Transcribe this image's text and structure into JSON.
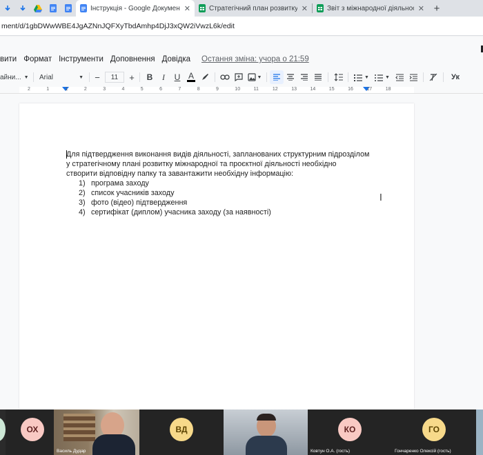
{
  "browser": {
    "tabs": [
      {
        "title": "Інструкція - Google Документи",
        "active": true,
        "icon_color": "#4285f4"
      },
      {
        "title": "Стратегічний план розвитку між",
        "active": false,
        "icon_color": "#0f9d58"
      },
      {
        "title": "Звіт з міжнародної діяльності -",
        "active": false,
        "icon_color": "#0f9d58"
      }
    ],
    "new_tab": "+",
    "close": "✕",
    "url": "ment/d/1gbDWwWBE4JgAZNnJQFXyTbdAmhp4DjJ3xQW2iVwzL6k/edit"
  },
  "docs": {
    "menu": [
      "вити",
      "Формат",
      "Інструменти",
      "Доповнення",
      "Довідка"
    ],
    "last_edit": "Остання зміна: учора о 21:59",
    "toolbar": {
      "style": "айни...",
      "font": "Arial",
      "font_size": "11",
      "minus": "−",
      "plus": "+",
      "bold": "B",
      "italic": "I",
      "underline": "U",
      "text_color": "A",
      "style_suffix": "Ук"
    },
    "ruler_ticks": [
      "2",
      "1",
      "1",
      "2",
      "3",
      "4",
      "5",
      "6",
      "7",
      "8",
      "9",
      "10",
      "11",
      "12",
      "13",
      "14",
      "15",
      "16",
      "17",
      "18"
    ],
    "body": {
      "lines": [
        "Для підтвердження виконання видів діяльності, запланованих структурним підрозділом",
        "у стратегічному плані розвитку міжнародної та проєктної діяльності необхідно",
        "створити відповідну папку та завантажити необхідну  інформацію:"
      ],
      "list": [
        {
          "num": "1)",
          "text": "програма заходу"
        },
        {
          "num": "2)",
          "text": "список учасників заходу"
        },
        {
          "num": "3)",
          "text": "фото (відео) підтвердження"
        },
        {
          "num": "4)",
          "text": "сертифікат (диплом) учасника заходу (за наявності)"
        }
      ]
    }
  },
  "meeting": {
    "participants": [
      {
        "initials": "ОХ",
        "color": "#f9c9c3",
        "text_color": "#5f2120"
      },
      {
        "name": "Василь Дудар",
        "video": true
      },
      {
        "initials": "ВД",
        "color": "#f7d98a",
        "text_color": "#5c4300"
      },
      {
        "video": true
      },
      {
        "initials": "КО",
        "color": "#f9c9c3",
        "text_color": "#5f2120",
        "name": "Ковтун О.А. (гость)"
      },
      {
        "initials": "ГО",
        "color": "#f7d98a",
        "text_color": "#5c4300",
        "name": "Гончаренко Олексій (гость)"
      }
    ]
  },
  "colors": {
    "accent": "#1a73e8",
    "docs_blue": "#4285f4",
    "sheets_green": "#0f9d58"
  }
}
